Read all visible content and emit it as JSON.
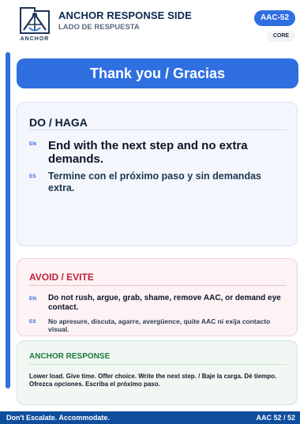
{
  "header": {
    "logo_text": "ANCHOR",
    "title": "ANCHOR RESPONSE SIDE",
    "subtitle": "LADO DE RESPUESTA",
    "code": "AAC-52",
    "tag": "CORE"
  },
  "banner": {
    "text": "Thank you / Gracias"
  },
  "do_section": {
    "title": "DO / HAGA",
    "en_tag": "EN",
    "en_text": "End with the next step and no extra demands.",
    "es_tag": "ES",
    "es_text": "Termine con el próximo paso y sin demandas extra."
  },
  "avoid_section": {
    "title": "AVOID / EVITE",
    "en_tag": "EN",
    "en_text": "Do not rush, argue, grab, shame, remove AAC, or demand eye contact.",
    "es_tag": "ES",
    "es_text": "No apresure, discuta, agarre, avergüence, quite AAC ni exija contacto visual."
  },
  "anchor_section": {
    "title": "ANCHOR RESPONSE",
    "text": "Lower load. Give time. Offer choice. Write the next step. / Baje la carga. Dé tiempo. Ofrezca opciones. Escriba el próximo paso."
  },
  "footer": {
    "left": "Don't Escalate. Accommodate.",
    "right": "AAC 52 / 52"
  },
  "colors": {
    "accent": "#2f6fe0",
    "navy": "#0f4e9c",
    "avoid": "#c0223b",
    "anchor": "#1e7a3a"
  }
}
